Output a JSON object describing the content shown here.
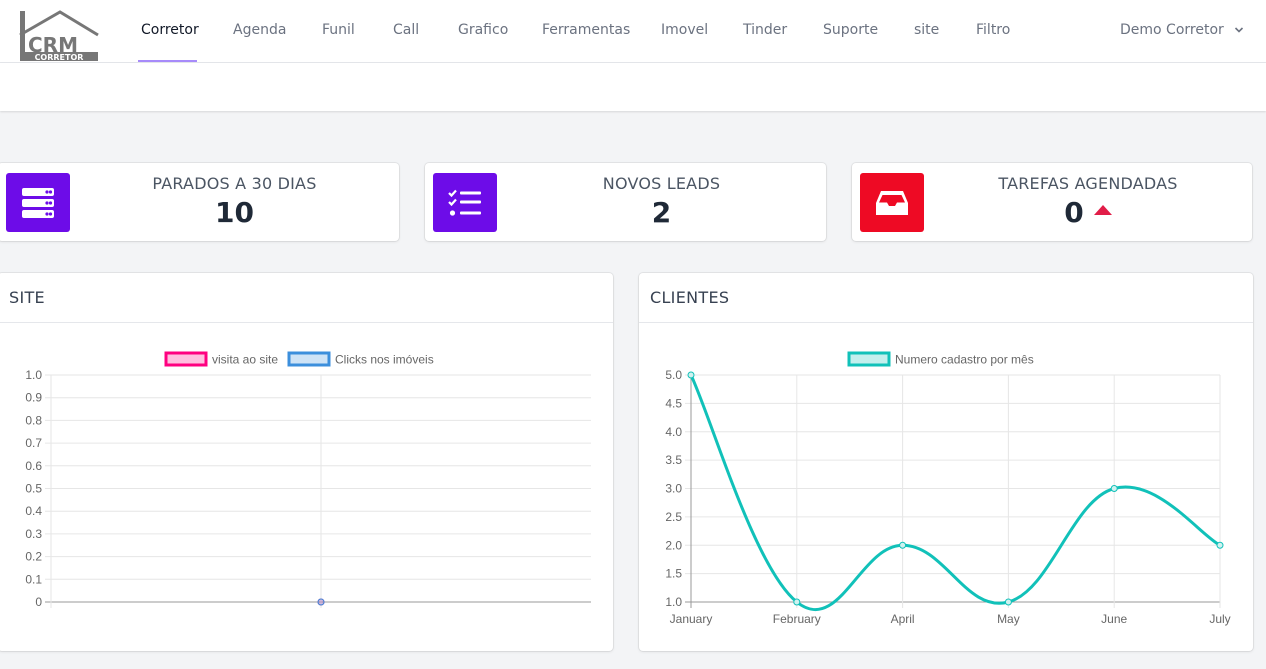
{
  "brand": {
    "logo_text": "CRM",
    "logo_subtext": "CORRETOR"
  },
  "nav": {
    "items": [
      {
        "label": "Corretor",
        "active": true
      },
      {
        "label": "Agenda"
      },
      {
        "label": "Funil"
      },
      {
        "label": "Call"
      },
      {
        "label": "Grafico"
      },
      {
        "label": "Ferramentas"
      },
      {
        "label": "Imovel"
      },
      {
        "label": "Tinder"
      },
      {
        "label": "Suporte"
      },
      {
        "label": "site"
      },
      {
        "label": "Filtro"
      }
    ],
    "user_name": "Demo Corretor",
    "user_icon": "chevron-down-icon"
  },
  "stats": [
    {
      "title": "PARADOS A 30 DIAS",
      "value": "10",
      "icon": "server-icon",
      "color": "#6d0ce8"
    },
    {
      "title": "NOVOS LEADS",
      "value": "2",
      "icon": "checklist-icon",
      "color": "#6d0ce8"
    },
    {
      "title": "TAREFAS AGENDADAS",
      "value": "0",
      "icon": "inbox-icon",
      "color": "#ee0a24",
      "trend": "up"
    }
  ],
  "panels": {
    "site_title": "SITE",
    "clientes_title": "CLIENTES"
  },
  "chart_data": [
    {
      "type": "line",
      "x": [
        ""
      ],
      "series": [
        {
          "name": "visita ao site",
          "values": [
            0
          ],
          "color": "#ff0080"
        },
        {
          "name": "Clicks nos imóveis",
          "values": [
            0
          ],
          "color": "#3c8fdc"
        }
      ],
      "yticks": [
        "1.0",
        "0.9",
        "0.8",
        "0.7",
        "0.6",
        "0.5",
        "0.4",
        "0.3",
        "0.2",
        "0.1",
        "0"
      ],
      "ylim": [
        0,
        1
      ],
      "grid": true,
      "legend": "top-center"
    },
    {
      "type": "line",
      "categories": [
        "January",
        "February",
        "April",
        "May",
        "June",
        "July"
      ],
      "series": [
        {
          "name": "Numero cadastro por mês",
          "values": [
            5,
            1,
            2,
            1,
            3,
            2
          ],
          "color": "#11c1b9"
        }
      ],
      "yticks": [
        "5.0",
        "4.5",
        "4.0",
        "3.5",
        "3.0",
        "2.5",
        "2.0",
        "1.5",
        "1.0"
      ],
      "ylim": [
        1,
        5
      ],
      "grid": true,
      "legend": "top-center"
    }
  ]
}
